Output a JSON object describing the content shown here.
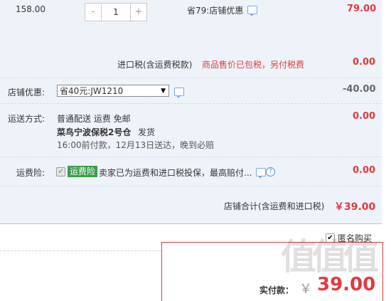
{
  "item": {
    "price": "158.00",
    "quantity": "1",
    "minus": "-",
    "plus": "+",
    "shop_discount": "省79:店铺优惠",
    "subtotal": "79.00"
  },
  "tax": {
    "label": "进口税(含运费税款)",
    "note": "商品售价已包税，另付税费",
    "amount": "0.00"
  },
  "shop_coupon": {
    "label": "店铺优惠:",
    "selected": "省40元:JW1210",
    "amount": "-40.00"
  },
  "shipping": {
    "label": "运送方式:",
    "method": "普通配送 运费 免邮",
    "warehouse": "菜鸟宁波保税2号仓",
    "dispatch": "发货",
    "eta": "16:00前付款，12月13日送达，晚到必赔",
    "amount": "0.00"
  },
  "insurance": {
    "label": "运费险:",
    "badge": "运费险",
    "text": "卖家已为运费和进口税投保，最高赔付...",
    "help": "?",
    "amount": "0.00"
  },
  "shop_total": {
    "label": "店铺合计(含运费和进口税)",
    "amount": "￥39.00"
  },
  "anonymous": {
    "check": "✔",
    "label": "匿名购买"
  },
  "payment": {
    "label": "实付款：",
    "currency": "￥",
    "amount": "39.00"
  },
  "watermark": "值值值",
  "colors": {
    "accent": "#e4393c",
    "panel": "#eef3fa",
    "badge": "#3b9b4a"
  }
}
